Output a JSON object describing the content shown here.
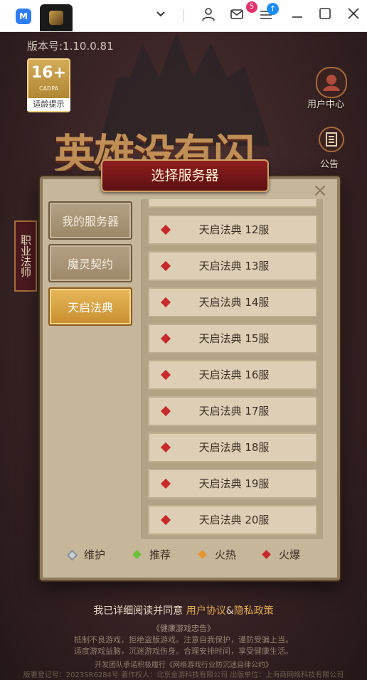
{
  "titlebar": {
    "app_logo": "M",
    "mail_badge": "5",
    "icons": [
      "chevron-down-icon",
      "user-icon",
      "mail-icon",
      "menu-icon",
      "minimize-icon",
      "maximize-icon",
      "close-icon"
    ]
  },
  "game": {
    "version": "版本号:1.10.0.81",
    "age_rating": "16+",
    "age_org": "CADPA",
    "age_tip": "适龄提示",
    "user_center": "用户中心",
    "notice": "公告",
    "title": "英雄没有闪",
    "job_banner": "职业法师"
  },
  "dialog": {
    "title": "选择服务器",
    "close": "×",
    "tabs": [
      {
        "label": "我的服务器",
        "active": false
      },
      {
        "label": "魔灵契约",
        "active": false
      },
      {
        "label": "天启法典",
        "active": true
      }
    ],
    "servers": [
      {
        "name": "天启法典 12服",
        "status": "hot-full"
      },
      {
        "name": "天启法典 13服",
        "status": "hot-full"
      },
      {
        "name": "天启法典 14服",
        "status": "hot-full"
      },
      {
        "name": "天启法典 15服",
        "status": "hot-full"
      },
      {
        "name": "天启法典 16服",
        "status": "hot-full"
      },
      {
        "name": "天启法典 17服",
        "status": "hot-full"
      },
      {
        "name": "天启法典 18服",
        "status": "hot-full"
      },
      {
        "name": "天启法典 19服",
        "status": "hot-full"
      },
      {
        "name": "天启法典 20服",
        "status": "hot-full"
      }
    ],
    "legend": [
      {
        "label": "维护",
        "color": "#8a8f99"
      },
      {
        "label": "推荐",
        "color": "#6cc23a"
      },
      {
        "label": "火热",
        "color": "#e8952e"
      },
      {
        "label": "火爆",
        "color": "#c8292b"
      }
    ]
  },
  "footer": {
    "agree_prefix": "我已详细阅读并同意",
    "user_agreement": "用户协议",
    "amp": "&",
    "privacy": "隐私政策",
    "health_title": "《健康游戏忠告》",
    "health_line1": "抵制不良游戏，拒绝盗版游戏。注意自我保护，谨防受骗上当。",
    "health_line2": "适度游戏益脑，沉迷游戏伤身。合理安排时间，享受健康生活。",
    "license_line": "开发团队承诺积极履行《网络游戏行业防沉迷自律公约》",
    "copyright_line": "版署登记号：2023SR6284号  著作权人：北京金游科技有限公司  出版单位：上海商网络科技有限公司"
  }
}
